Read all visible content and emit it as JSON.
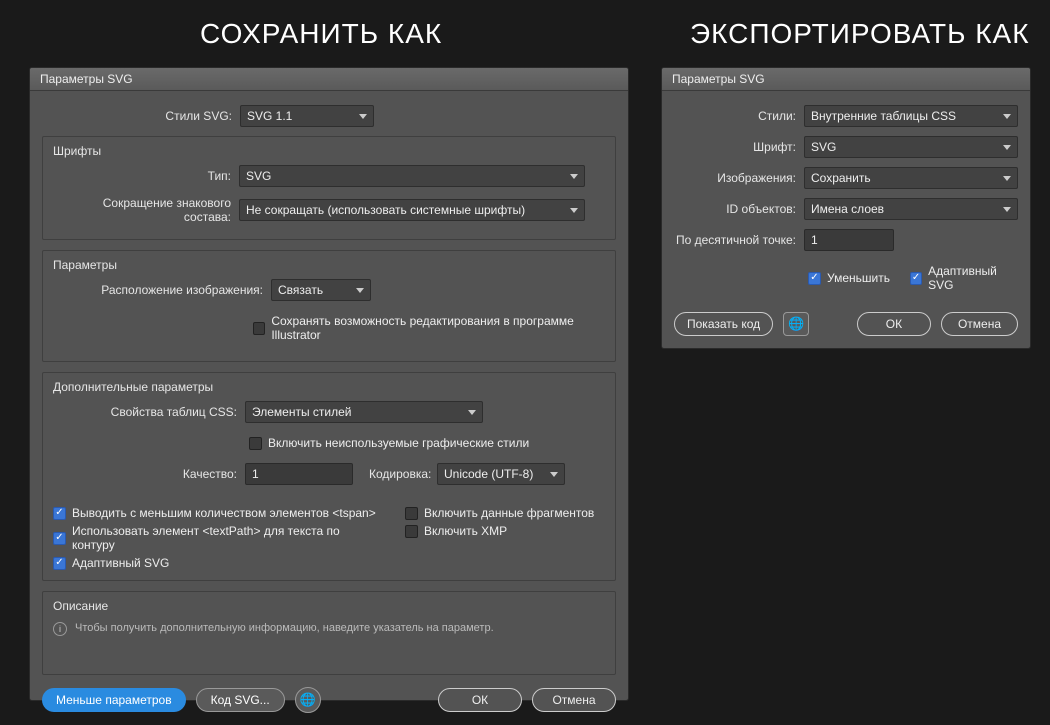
{
  "headings": {
    "save_as": "СОХРАНИТЬ КАК",
    "export_as": "ЭКСПОРТИРОВАТЬ КАК"
  },
  "left": {
    "title": "Параметры SVG",
    "svg_styles_label": "Стили SVG:",
    "svg_styles_value": "SVG 1.1",
    "fonts_group": "Шрифты",
    "type_label": "Тип:",
    "type_value": "SVG",
    "subset_label": "Сокращение знакового состава:",
    "subset_value": "Не сокращать (использовать системные шрифты)",
    "params_group": "Параметры",
    "image_loc_label": "Расположение изображения:",
    "image_loc_value": "Связать",
    "preserve_edit": "Сохранять возможность редактирования в программе Illustrator",
    "advanced_group": "Дополнительные параметры",
    "css_props_label": "Свойства таблиц CSS:",
    "css_props_value": "Элементы стилей",
    "include_unused": "Включить неиспользуемые графические стили",
    "quality_label": "Качество:",
    "quality_value": "1",
    "encoding_label": "Кодировка:",
    "encoding_value": "Unicode (UTF-8)",
    "fewer_tspan": "Выводить с меньшим количеством элементов <tspan>",
    "include_slice": "Включить данные фрагментов",
    "use_textpath": "Использовать элемент <textPath> для текста по контуру",
    "include_xmp": "Включить XMP",
    "responsive": "Адаптивный SVG",
    "desc_group": "Описание",
    "desc_text": "Чтобы получить дополнительную информацию, наведите указатель на параметр.",
    "less_params": "Меньше параметров",
    "svg_code": "Код SVG...",
    "ok": "ОК",
    "cancel": "Отмена"
  },
  "right": {
    "title": "Параметры SVG",
    "styles_label": "Стили:",
    "styles_value": "Внутренние таблицы CSS",
    "font_label": "Шрифт:",
    "font_value": "SVG",
    "images_label": "Изображения:",
    "images_value": "Сохранить",
    "obj_ids_label": "ID объектов:",
    "obj_ids_value": "Имена слоев",
    "decimal_label": "По десятичной точке:",
    "decimal_value": "1",
    "minify": "Уменьшить",
    "responsive": "Адаптивный SVG",
    "show_code": "Показать код",
    "ok": "ОК",
    "cancel": "Отмена"
  }
}
